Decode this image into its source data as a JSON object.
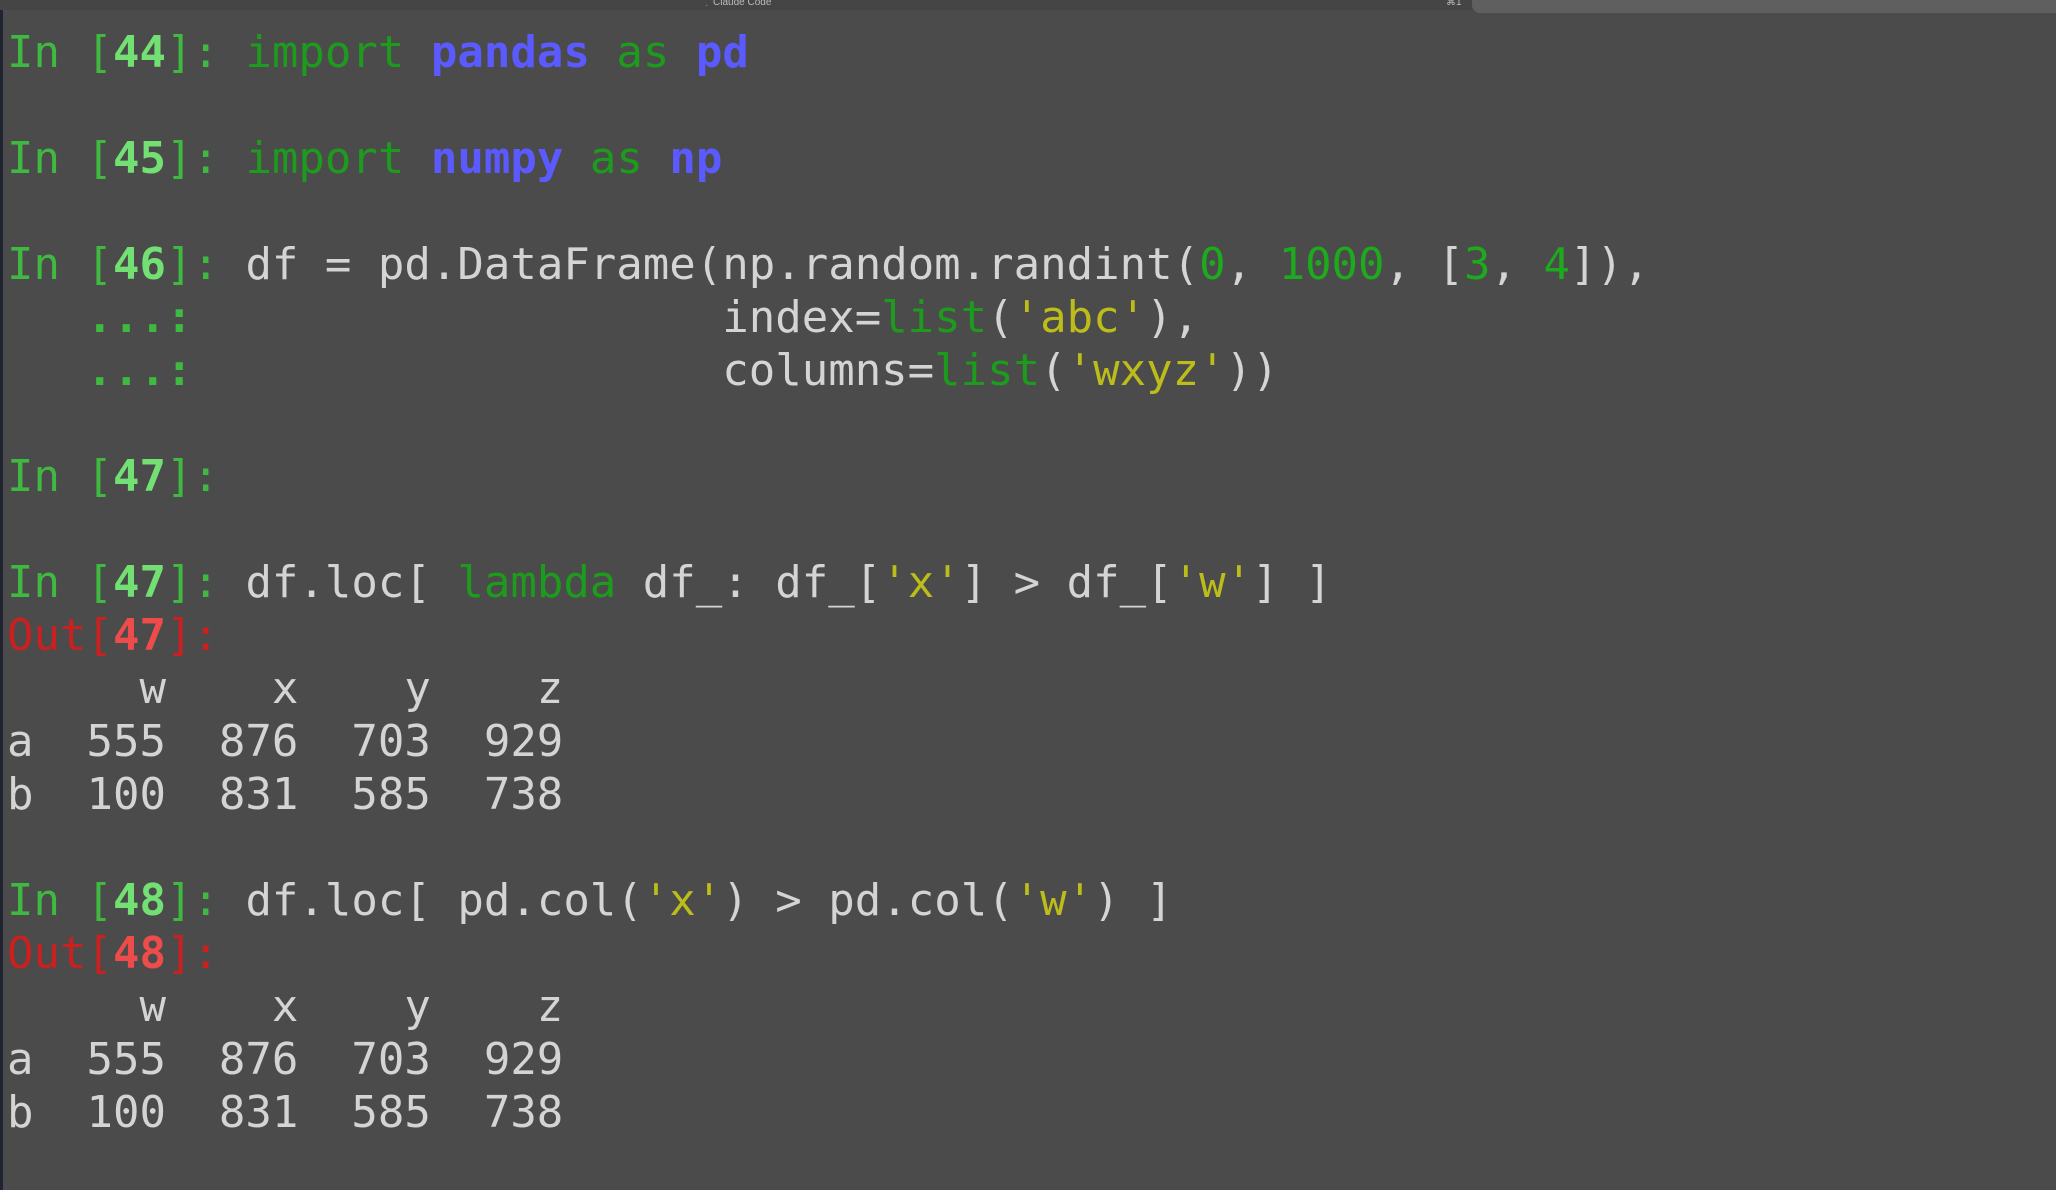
{
  "window": {
    "title": "Claude Code",
    "shortcut": "⌘1"
  },
  "cells": [
    {
      "prompt": "In [",
      "n": "44",
      "end": "]: ",
      "tokens": [
        [
          "kw",
          "import"
        ],
        [
          "plain",
          " "
        ],
        [
          "mod",
          "pandas"
        ],
        [
          "plain",
          " "
        ],
        [
          "kw",
          "as"
        ],
        [
          "plain",
          " "
        ],
        [
          "mod",
          "pd"
        ]
      ]
    },
    {
      "prompt": "In [",
      "n": "45",
      "end": "]: ",
      "tokens": [
        [
          "kw",
          "import"
        ],
        [
          "plain",
          " "
        ],
        [
          "mod",
          "numpy"
        ],
        [
          "plain",
          " "
        ],
        [
          "kw",
          "as"
        ],
        [
          "plain",
          " "
        ],
        [
          "mod",
          "np"
        ]
      ]
    },
    {
      "prompt": "In [",
      "n": "46",
      "end": "]: ",
      "tokens": [
        [
          "plain",
          "df = pd.DataFrame(np.random.randint("
        ],
        [
          "num",
          "0"
        ],
        [
          "plain",
          ", "
        ],
        [
          "num",
          "1000"
        ],
        [
          "plain",
          ", ["
        ],
        [
          "num",
          "3"
        ],
        [
          "plain",
          ", "
        ],
        [
          "num",
          "4"
        ],
        [
          "plain",
          "]),"
        ]
      ]
    },
    {
      "cont": "   ...: ",
      "tokens": [
        [
          "plain",
          "                   index="
        ],
        [
          "bi",
          "list"
        ],
        [
          "plain",
          "("
        ],
        [
          "str",
          "'abc'"
        ],
        [
          "plain",
          "),"
        ]
      ]
    },
    {
      "cont": "   ...: ",
      "tokens": [
        [
          "plain",
          "                   columns="
        ],
        [
          "bi",
          "list"
        ],
        [
          "plain",
          "("
        ],
        [
          "str",
          "'wxyz'"
        ],
        [
          "plain",
          "))"
        ]
      ]
    },
    {
      "prompt": "In [",
      "n": "47",
      "end": "]: ",
      "tokens": []
    },
    {
      "prompt": "In [",
      "n": "47",
      "end": "]: ",
      "tokens": [
        [
          "plain",
          "df.loc[ "
        ],
        [
          "kw",
          "lambda"
        ],
        [
          "plain",
          " df_: df_["
        ],
        [
          "str",
          "'x'"
        ],
        [
          "plain",
          "] > df_["
        ],
        [
          "str",
          "'w'"
        ],
        [
          "plain",
          "] ]"
        ]
      ]
    },
    {
      "out": "Out[",
      "n": "47",
      "end": "]: "
    },
    {
      "text": "     w    x    y    z"
    },
    {
      "text": "a  555  876  703  929"
    },
    {
      "text": "b  100  831  585  738"
    },
    {
      "prompt": "In [",
      "n": "48",
      "end": "]: ",
      "tokens": [
        [
          "plain",
          "df.loc[ pd.col("
        ],
        [
          "str",
          "'x'"
        ],
        [
          "plain",
          ") > pd.col("
        ],
        [
          "str",
          "'w'"
        ],
        [
          "plain",
          ") ]"
        ]
      ]
    },
    {
      "out": "Out[",
      "n": "48",
      "end": "]: "
    },
    {
      "text": "     w    x    y    z"
    },
    {
      "text": "a  555  876  703  929"
    },
    {
      "text": "b  100  831  585  738"
    }
  ]
}
